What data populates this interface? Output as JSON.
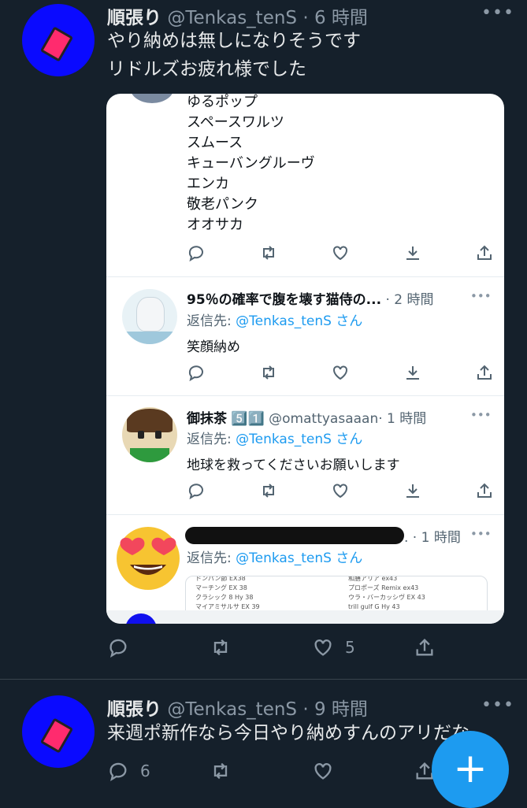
{
  "tweet1": {
    "name": "順張り",
    "handle": "@Tenkas_tenS",
    "time": "· 6 時間",
    "more": "•••",
    "line1": "やり納めは無しになりそうです",
    "line2": "リドルズお疲れ様でした",
    "likes": "5"
  },
  "embedded": {
    "top_lines": [
      "ゆるポップ",
      "スペースワルツ",
      "スムース",
      "キューバングルーヴ",
      "エンカ",
      "敬老パンク",
      "オオサカ"
    ],
    "reply1": {
      "name": "95％の確率で腹を壊す猫侍の...",
      "time": "· 2 時間",
      "reply_prefix": "返信先: ",
      "reply_to": "@Tenkas_tenS",
      "reply_suffix": " さん",
      "text": "笑顔納め"
    },
    "reply2": {
      "name": "御抹茶",
      "badges": "5️⃣1️⃣",
      "handle": "@omattyasaaan",
      "time": "· 1 時間",
      "reply_prefix": "返信先: ",
      "reply_to": "@Tenkas_tenS",
      "reply_suffix": " さん",
      "text": "地球を救ってくださいお願いします"
    },
    "reply3": {
      "time": ". · 1 時間",
      "reply_prefix": "返信先: ",
      "reply_to": "@Tenkas_tenS",
      "reply_suffix": " さん",
      "list_left": [
        "ドンパン節 EX38",
        "マーチング EX 38",
        "クラシック 8 Hy 38",
        "マイアミサルサ EX 39"
      ],
      "list_right": [
        "和膳アリア ex43",
        "プロポーズ Remix ex43",
        "ウラ・バーカッシヴ EX 43",
        "trill gulf G Hy 43"
      ]
    }
  },
  "tweet2": {
    "name": "順張り",
    "handle": "@Tenkas_tenS",
    "time": "· 9 時間",
    "more": "•••",
    "line1": "来週ポ新作なら今日やり納めすんのアリだな",
    "replies": "6"
  },
  "fab": {
    "label": "+"
  },
  "colors": {
    "background": "#15202b",
    "accent": "#1d9bf0",
    "secondary": "#8b98a5"
  }
}
